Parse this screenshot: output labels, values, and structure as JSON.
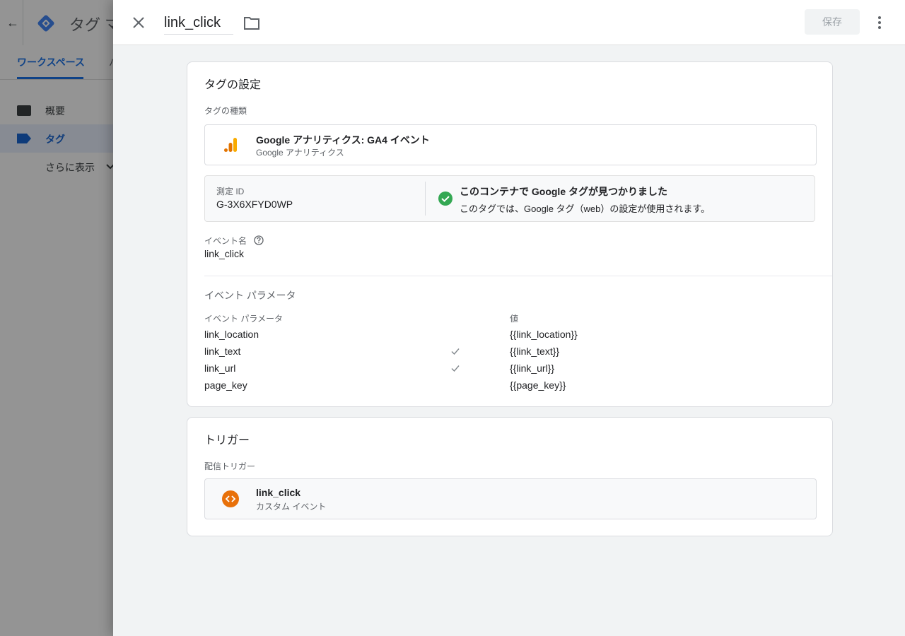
{
  "background": {
    "title": "タグ マ",
    "tab_active": "ワークスペース",
    "tab_next": "バ",
    "sidebar": [
      {
        "label": "概要",
        "icon": "folder-icon"
      },
      {
        "label": "タグ",
        "icon": "label-icon",
        "active": true
      },
      {
        "label": "さらに表示",
        "icon": "chevron-down-icon"
      }
    ]
  },
  "panel": {
    "tag_name": "link_click",
    "save_label": "保存",
    "tag_config": {
      "title": "タグの設定",
      "type_label": "タグの種類",
      "type_name": "Google アナリティクス: GA4 イベント",
      "type_sub": "Google アナリティクス",
      "measurement_id_label": "測定 ID",
      "measurement_id": "G-3X6XFYD0WP",
      "found_title": "このコンテナで Google タグが見つかりました",
      "found_desc": "このタグでは、Google タグ（web）の設定が使用されます。",
      "event_name_label": "イベント名",
      "event_name": "link_click",
      "params_title": "イベント パラメータ",
      "params_header_name": "イベント パラメータ",
      "params_header_value": "値",
      "params": [
        {
          "name": "link_location",
          "value": "{{link_location}}",
          "checked": false
        },
        {
          "name": "link_text",
          "value": "{{link_text}}",
          "checked": true
        },
        {
          "name": "link_url",
          "value": "{{link_url}}",
          "checked": true
        },
        {
          "name": "page_key",
          "value": "{{page_key}}",
          "checked": false
        }
      ]
    },
    "trigger": {
      "title": "トリガー",
      "firing_label": "配信トリガー",
      "name": "link_click",
      "type": "カスタム イベント"
    }
  },
  "colors": {
    "accent": "#1a73e8",
    "ga_orange": "#f9ab00",
    "ga_dark": "#e37400",
    "trigger_orange": "#e8710a",
    "success_green": "#34a853"
  }
}
